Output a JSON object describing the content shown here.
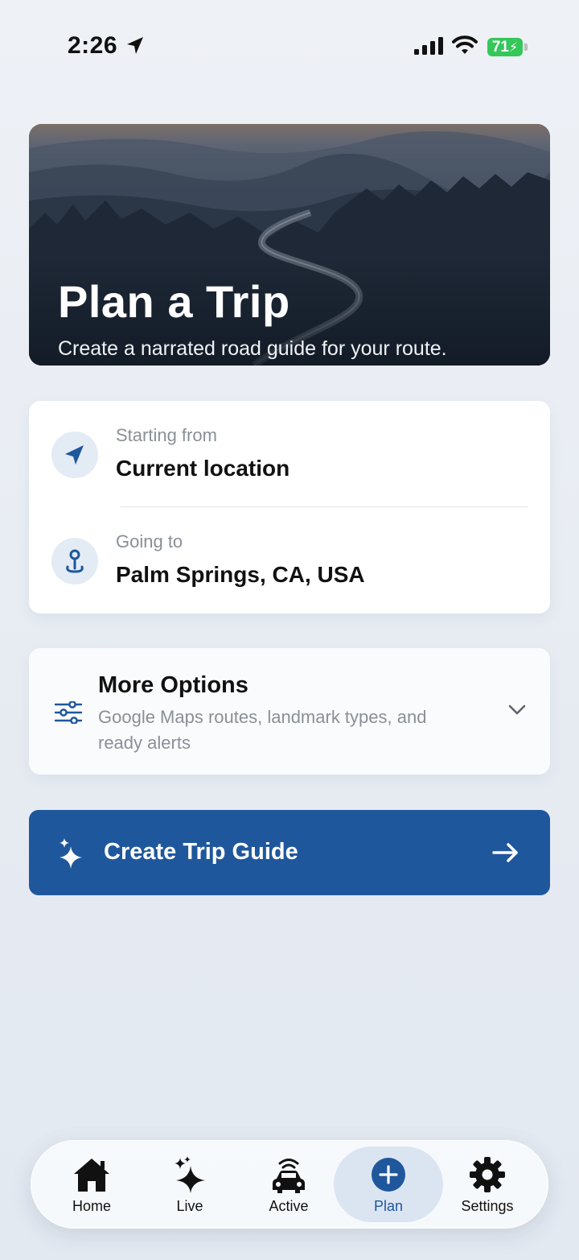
{
  "status_bar": {
    "time": "2:26",
    "battery": "71",
    "icons": [
      "location-arrow-icon",
      "cellular-signal-icon",
      "wifi-icon",
      "battery-charging-icon"
    ]
  },
  "hero": {
    "title": "Plan a Trip",
    "subtitle": "Create a narrated road guide for your route."
  },
  "route": {
    "start": {
      "label": "Starting from",
      "value": "Current location",
      "icon": "navigation-arrow-icon"
    },
    "destination": {
      "label": "Going to",
      "value": "Palm Springs, CA, USA",
      "icon": "map-pin-icon"
    }
  },
  "options": {
    "title": "More Options",
    "description": "Google Maps routes, landmark types, and ready alerts",
    "icon": "sliders-icon",
    "expand_icon": "chevron-down-icon"
  },
  "create_button": {
    "label": "Create Trip Guide",
    "leading_icon": "sparkles-icon",
    "trailing_icon": "arrow-right-icon"
  },
  "tabs": [
    {
      "label": "Home",
      "icon": "house-icon",
      "active": false
    },
    {
      "label": "Live",
      "icon": "sparkles-icon",
      "active": false
    },
    {
      "label": "Active",
      "icon": "car-radio-icon",
      "active": false
    },
    {
      "label": "Plan",
      "icon": "plus-circle-icon",
      "active": true
    },
    {
      "label": "Settings",
      "icon": "gear-icon",
      "active": false
    }
  ],
  "colors": {
    "accent": "#1f579c",
    "background": "#e8edf3",
    "card": "#ffffff",
    "secondary_text": "#8a8f98",
    "battery": "#34c759"
  }
}
